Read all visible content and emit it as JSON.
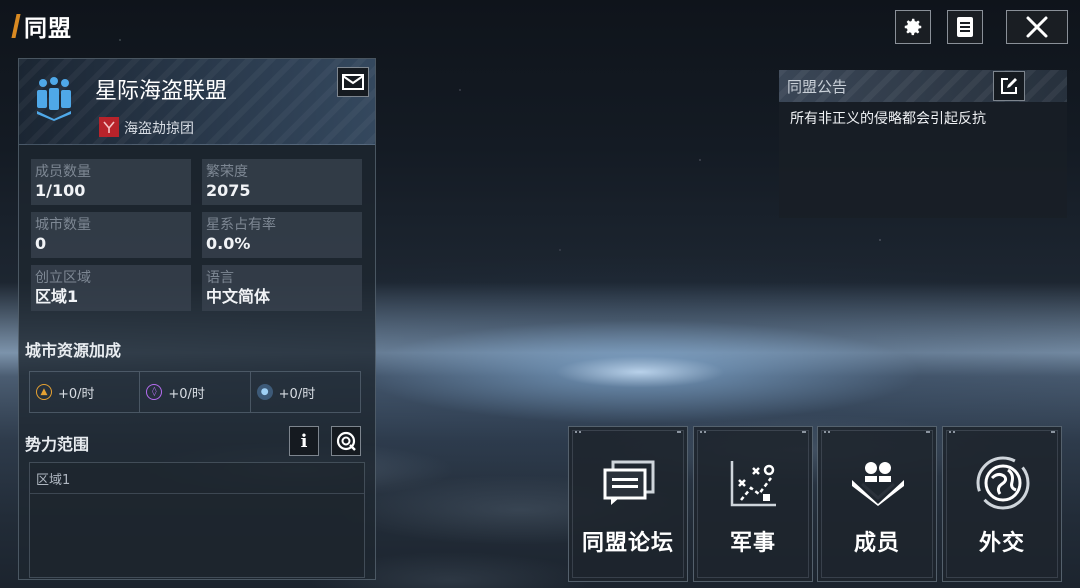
{
  "title": "同盟",
  "alliance": {
    "name": "星际海盗联盟",
    "tag": "海盗劫掠团"
  },
  "stats": [
    {
      "label": "成员数量",
      "value": "1/100"
    },
    {
      "label": "繁荣度",
      "value": "2075"
    },
    {
      "label": "城市数量",
      "value": "0"
    },
    {
      "label": "星系占有率",
      "value": "0.0%"
    },
    {
      "label": "创立区域",
      "value": "区域1"
    },
    {
      "label": "语言",
      "value": "中文简体"
    }
  ],
  "resources": {
    "title": "城市资源加成",
    "items": [
      {
        "value": "+0/时",
        "icon": "triangle-resource-icon",
        "color": "#e5a132"
      },
      {
        "value": "+0/时",
        "icon": "crystal-resource-icon",
        "color": "#b56cf0"
      },
      {
        "value": "+0/时",
        "icon": "gas-resource-icon",
        "color": "#6fa6d8"
      }
    ]
  },
  "territory": {
    "title": "势力范围",
    "info_label": "i",
    "region": "区域1"
  },
  "announcement": {
    "title": "同盟公告",
    "text": "所有非正义的侵略都会引起反抗"
  },
  "actions": [
    {
      "label": "同盟论坛",
      "icon": "forum-icon"
    },
    {
      "label": "军事",
      "icon": "tactics-icon"
    },
    {
      "label": "成员",
      "icon": "members-icon"
    },
    {
      "label": "外交",
      "icon": "diplomacy-icon"
    }
  ],
  "colors": {
    "accent": "#d98a22",
    "tag_red": "#b8232b",
    "emblem_blue": "#4fa8e8"
  }
}
